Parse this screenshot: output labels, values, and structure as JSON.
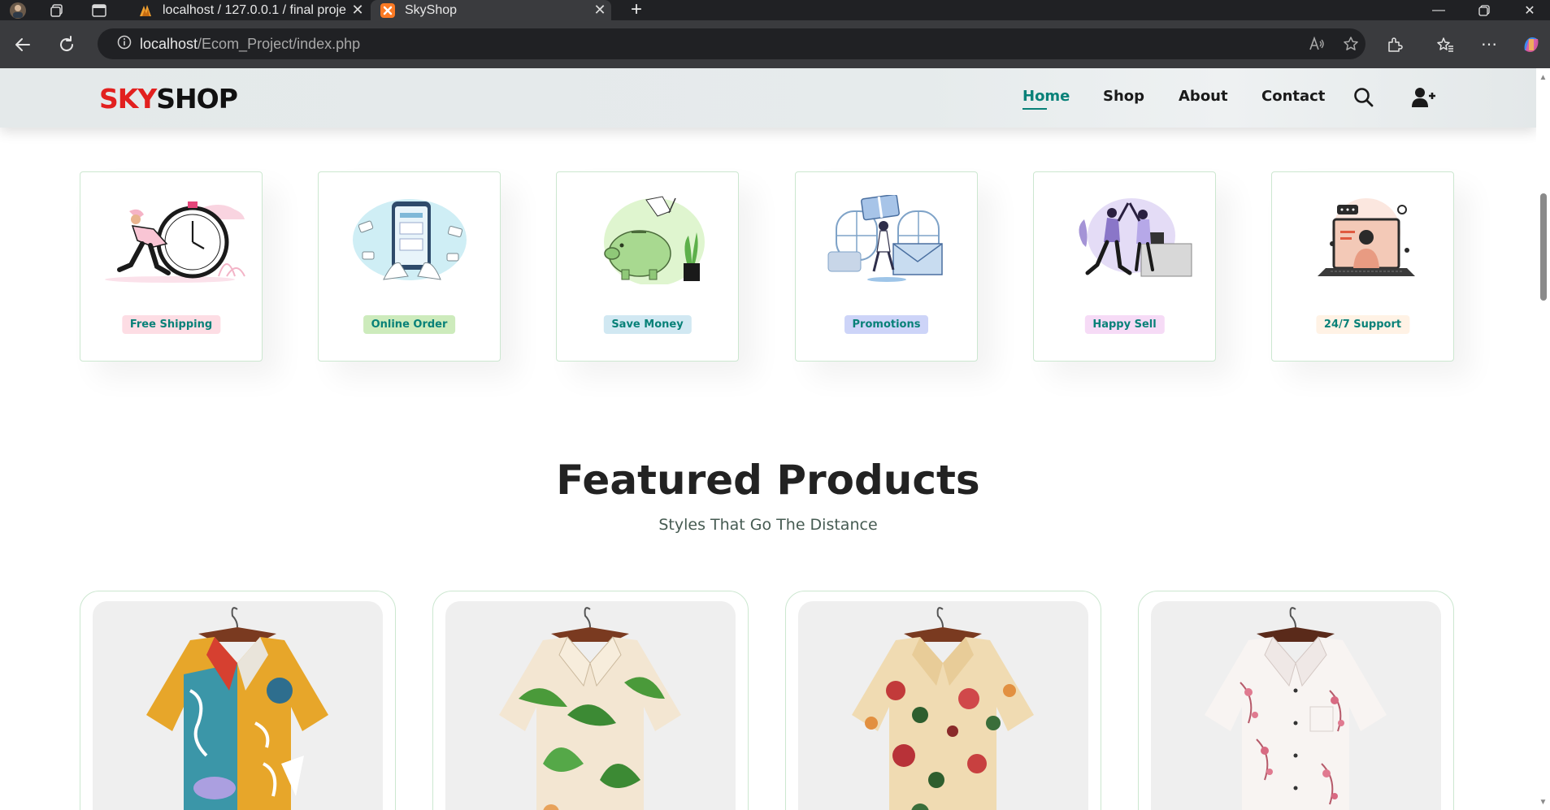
{
  "browser": {
    "tabs": [
      {
        "title": "localhost / 127.0.0.1 / final project",
        "active": false
      },
      {
        "title": "SkyShop",
        "active": true
      }
    ],
    "url_host": "localhost",
    "url_path": "/Ecom_Project/index.php"
  },
  "site": {
    "logo_part1": "SKY",
    "logo_part2": "SHOP",
    "nav": [
      "Home",
      "Shop",
      "About",
      "Contact"
    ],
    "active_nav": "Home",
    "accent_color": "#088178",
    "logo_red": "#e2201f"
  },
  "features": [
    {
      "label": "Free Shipping",
      "bg": "#fddde4",
      "icon": "delivery-clock-illustration"
    },
    {
      "label": "Online Order",
      "bg": "#cdebbc",
      "icon": "phone-payment-illustration"
    },
    {
      "label": "Save Money",
      "bg": "#d1e8f2",
      "icon": "piggy-bank-illustration"
    },
    {
      "label": "Promotions",
      "bg": "#cdd4f8",
      "icon": "gift-mail-illustration"
    },
    {
      "label": "Happy Sell",
      "bg": "#f6dbf6",
      "icon": "high-five-illustration"
    },
    {
      "label": "24/7 Support",
      "bg": "#fff2e5",
      "icon": "laptop-support-illustration"
    }
  ],
  "featured": {
    "title": "Featured Products",
    "subtitle": "Styles That Go The Distance",
    "products": [
      {
        "image": "patterned-shirt-abstract"
      },
      {
        "image": "patterned-shirt-leaves"
      },
      {
        "image": "patterned-shirt-florals"
      },
      {
        "image": "patterned-shirt-pink-blossom"
      }
    ]
  }
}
